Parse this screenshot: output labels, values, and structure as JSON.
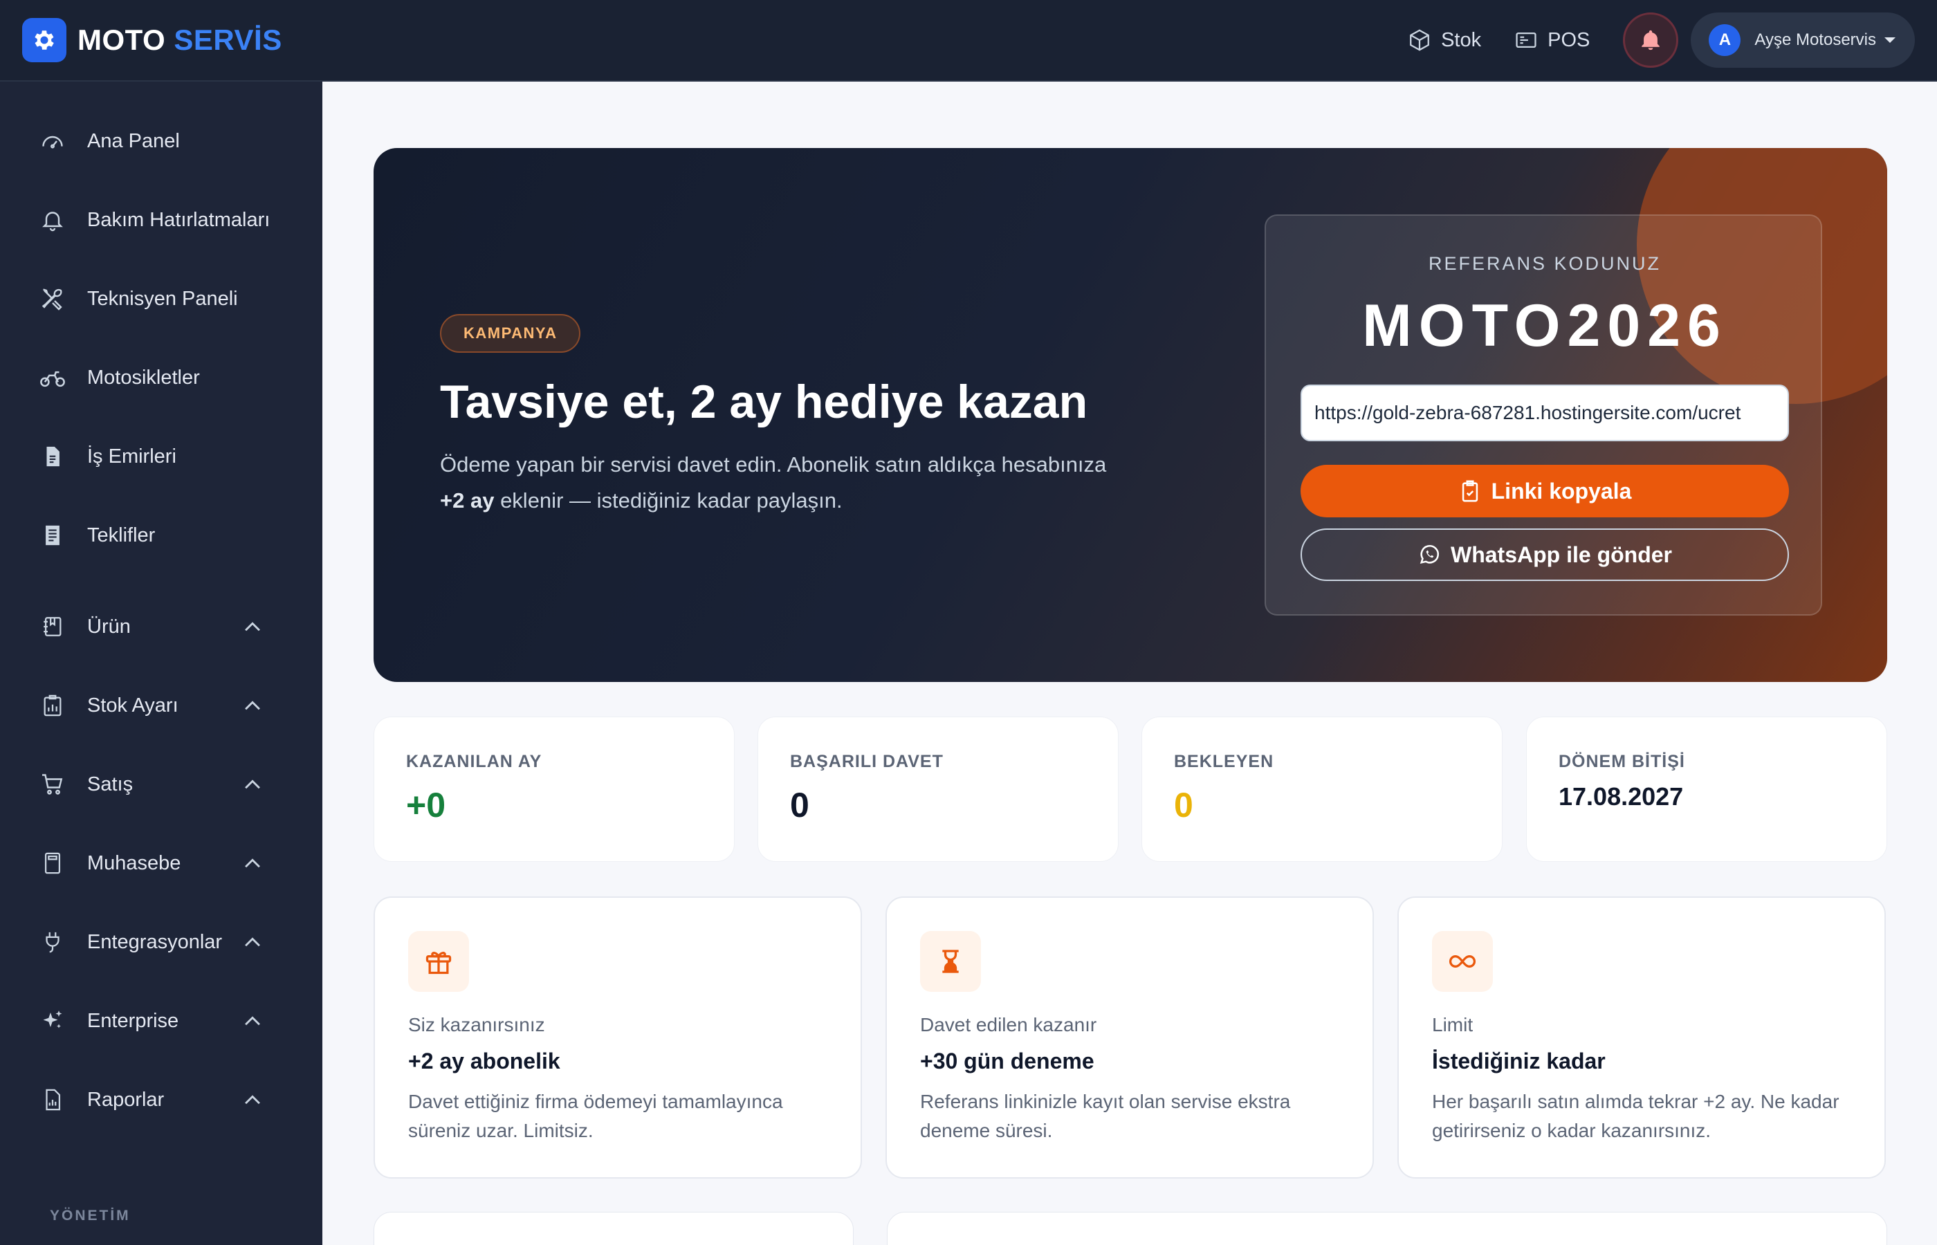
{
  "brand": {
    "part1": "MOTO",
    "part2": "SERVİS",
    "icon": "gear-icon",
    "accent": "#2563eb"
  },
  "topbar": {
    "stock_label": "Stok",
    "pos_label": "POS",
    "notifications_icon": "bell-icon",
    "user_initial": "A",
    "user_name": "Ayşe Motoservis"
  },
  "sidebar": {
    "items": [
      {
        "label": "Ana Panel",
        "icon": "dashboard-gauge-icon"
      },
      {
        "label": "Bakım Hatırlatmaları",
        "icon": "bell-icon"
      },
      {
        "label": "Teknisyen Paneli",
        "icon": "tools-icon"
      },
      {
        "label": "Motosikletler",
        "icon": "motorcycle-icon"
      },
      {
        "label": "İş Emirleri",
        "icon": "document-icon"
      },
      {
        "label": "Teklifler",
        "icon": "file-text-icon"
      },
      {
        "label": "Ürün",
        "icon": "journal-icon",
        "expandable": true
      },
      {
        "label": "Stok Ayarı",
        "icon": "clipboard-chart-icon",
        "expandable": true
      },
      {
        "label": "Satış",
        "icon": "cart-icon",
        "expandable": true
      },
      {
        "label": "Muhasebe",
        "icon": "calculator-icon",
        "expandable": true
      },
      {
        "label": "Entegrasyonlar",
        "icon": "plug-icon",
        "expandable": true
      },
      {
        "label": "Enterprise",
        "icon": "sparkles-icon",
        "expandable": true
      },
      {
        "label": "Raporlar",
        "icon": "report-chart-icon",
        "expandable": true
      }
    ],
    "section_label": "YÖNETİM"
  },
  "hero": {
    "badge": "KAMPANYA",
    "title": "Tavsiye et, 2 ay hediye kazan",
    "desc_line1": "Ödeme yapan bir servisi davet edin. Abonelik satın aldıkça hesabınıza",
    "desc_bold": "+2 ay",
    "desc_line2": " eklenir — istediğiniz kadar paylaşın.",
    "ref_label": "REFERANS KODUNUZ",
    "ref_code": "MOTO2026",
    "ref_link": "https://gold-zebra-687281.hostingersite.com/ucret",
    "copy_button": "Linki kopyala",
    "whatsapp_button": "WhatsApp ile gönder",
    "accent": "#ea580c"
  },
  "stats": [
    {
      "label": "KAZANILAN AY",
      "value": "+0",
      "color": "#16803c"
    },
    {
      "label": "BAŞARILI DAVET",
      "value": "0",
      "color": "#0f172a"
    },
    {
      "label": "BEKLEYEN",
      "value": "0",
      "color": "#eab308"
    },
    {
      "label": "DÖNEM BİTİŞİ",
      "value": "17.08.2027",
      "color": "#0f172a"
    }
  ],
  "info_cards": [
    {
      "icon": "gift-icon",
      "small": "Siz kazanırsınız",
      "title": "+2 ay abonelik",
      "desc": "Davet ettiğiniz firma ödemeyi tamamlayınca süreniz uzar. Limitsiz."
    },
    {
      "icon": "hourglass-icon",
      "small": "Davet edilen kazanır",
      "title": "+30 gün deneme",
      "desc": "Referans linkinizle kayıt olan servise ekstra deneme süresi."
    },
    {
      "icon": "infinity-icon",
      "small": "Limit",
      "title": "İstediğiniz kadar",
      "desc": "Her başarılı satın alımda tekrar +2 ay. Ne kadar getirirseniz o kadar kazanırsınız."
    }
  ]
}
